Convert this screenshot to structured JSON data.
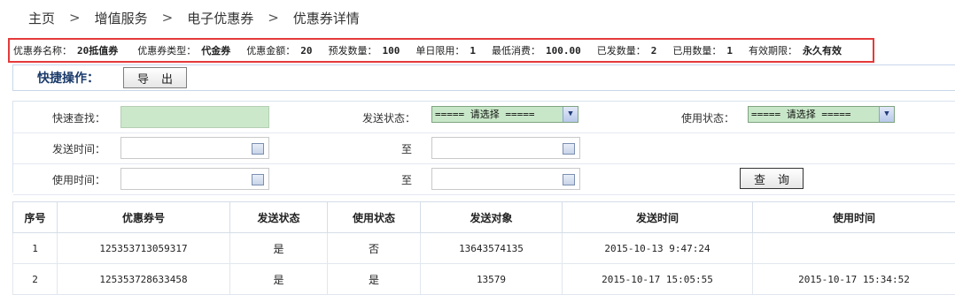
{
  "breadcrumb": [
    "主页",
    "增值服务",
    "电子优惠券",
    "优惠券详情"
  ],
  "coupon_info": [
    {
      "label": "优惠券名称：",
      "value": "20抵值券"
    },
    {
      "label": "优惠券类型：",
      "value": "代金券"
    },
    {
      "label": "优惠金额：",
      "value": "20"
    },
    {
      "label": "预发数量：",
      "value": "100"
    },
    {
      "label": "单日限用：",
      "value": "1"
    },
    {
      "label": "最低消费：",
      "value": "100.00"
    },
    {
      "label": "已发数量：",
      "value": "2"
    },
    {
      "label": "已用数量：",
      "value": "1"
    },
    {
      "label": "有效期限：",
      "value": "永久有效"
    }
  ],
  "quick": {
    "title": "快捷操作：",
    "export_label": "导出"
  },
  "filter": {
    "quick_search_label": "快速查找：",
    "send_status_label": "发送状态：",
    "send_status_value": "===== 请选择 =====",
    "use_status_label": "使用状态：",
    "use_status_value": "===== 请选择 =====",
    "send_time_label": "发送时间：",
    "use_time_label": "使用时间：",
    "to_label": "至",
    "query_label": "查询"
  },
  "table": {
    "headers": [
      "序号",
      "优惠券号",
      "发送状态",
      "使用状态",
      "发送对象",
      "发送时间",
      "使用时间"
    ],
    "rows": [
      [
        "1",
        "125353713059317",
        "是",
        "否",
        "13643574135",
        "2015-10-13 9:47:24",
        ""
      ],
      [
        "2",
        "125353728633458",
        "是",
        "是",
        "13579",
        "2015-10-17 15:05:55",
        "2015-10-17 15:34:52"
      ]
    ]
  }
}
